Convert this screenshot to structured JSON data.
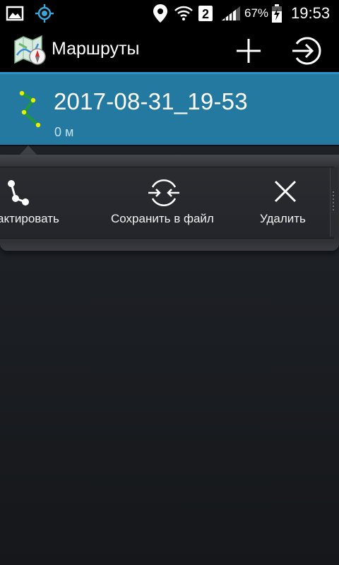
{
  "status_bar": {
    "icons": [
      "image-icon",
      "gps-icon",
      "location-icon",
      "wifi-icon",
      "sim-2-icon",
      "signal-icon",
      "battery-charging-icon"
    ],
    "sim_slot": "2",
    "battery_percent": "67%",
    "time": "19:53"
  },
  "action_bar": {
    "title": "Маршруты",
    "logo_icon": "map-app-icon",
    "actions": [
      "add-icon",
      "exit-icon"
    ]
  },
  "routes": [
    {
      "name": "2017-08-31_19-53",
      "distance": "0 м",
      "icon": "route-path-icon",
      "selected": true
    }
  ],
  "quick_actions": [
    {
      "label": "актировать",
      "icon": "route-edit-icon"
    },
    {
      "label": "Сохранить в файл",
      "icon": "save-to-file-icon"
    },
    {
      "label": "Удалить",
      "icon": "close-icon"
    }
  ],
  "colors": {
    "accent": "#2d93c5",
    "selected_row": "#2479a0",
    "background": "#1d2025",
    "route_line": "#1f9a3a",
    "route_points": "#e8f000"
  }
}
